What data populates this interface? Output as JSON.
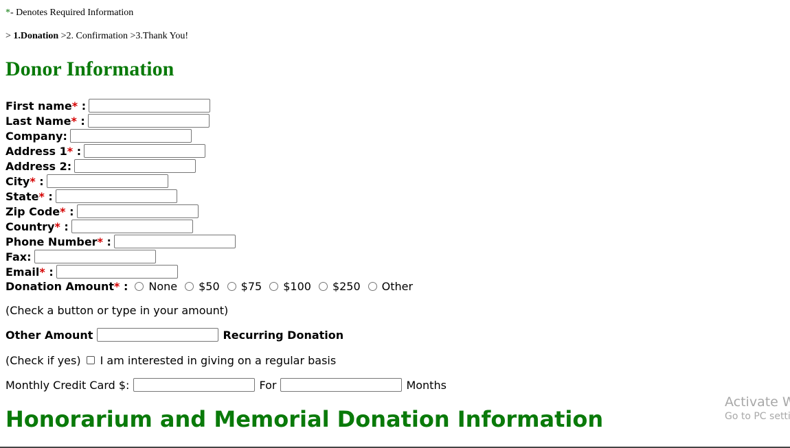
{
  "legend": {
    "star": "*",
    "text": "- Denotes Required Information"
  },
  "steps": {
    "prefix": ">",
    "step1": "1.Donation",
    "step2": ">2. Confirmation >3.Thank You!"
  },
  "donor_heading": "Donor Information",
  "fields": {
    "first_name": {
      "label": "First name",
      "suffix": " :"
    },
    "last_name": {
      "label": "Last Name",
      "suffix": " :"
    },
    "company": {
      "label": "Company:"
    },
    "address1": {
      "label": "Address 1",
      "suffix": " :"
    },
    "address2": {
      "label": "Address 2:"
    },
    "city": {
      "label": "City",
      "suffix": " :"
    },
    "state": {
      "label": "State",
      "suffix": " :"
    },
    "zip": {
      "label": "Zip Code",
      "suffix": " :"
    },
    "country": {
      "label": "Country",
      "suffix": " :"
    },
    "phone": {
      "label": "Phone Number",
      "suffix": " :"
    },
    "fax": {
      "label": "Fax:"
    },
    "email": {
      "label": "Email",
      "suffix": " :"
    }
  },
  "required_mark": "*",
  "donation": {
    "label": "Donation Amount",
    "suffix": " :",
    "options": [
      "None",
      "$50",
      "$75",
      "$100",
      "$250",
      "Other"
    ],
    "hint": "(Check a button or type in your amount)"
  },
  "other_amount": {
    "label": "Other Amount",
    "recurring_label": "Recurring Donation"
  },
  "recurring": {
    "check_label": "(Check if yes)",
    "option_text": "I am interested in giving on a regular basis"
  },
  "monthly": {
    "label": "Monthly Credit Card $:",
    "for_label": "For",
    "months_label": "Months"
  },
  "honor_heading": "Honorarium and Memorial Donation Information",
  "watermark": {
    "line1": "Activate Windows",
    "line2": "Go to PC settings to activate Windows."
  },
  "colors": {
    "heading": "#0a7a0a",
    "required": "#d40000"
  }
}
